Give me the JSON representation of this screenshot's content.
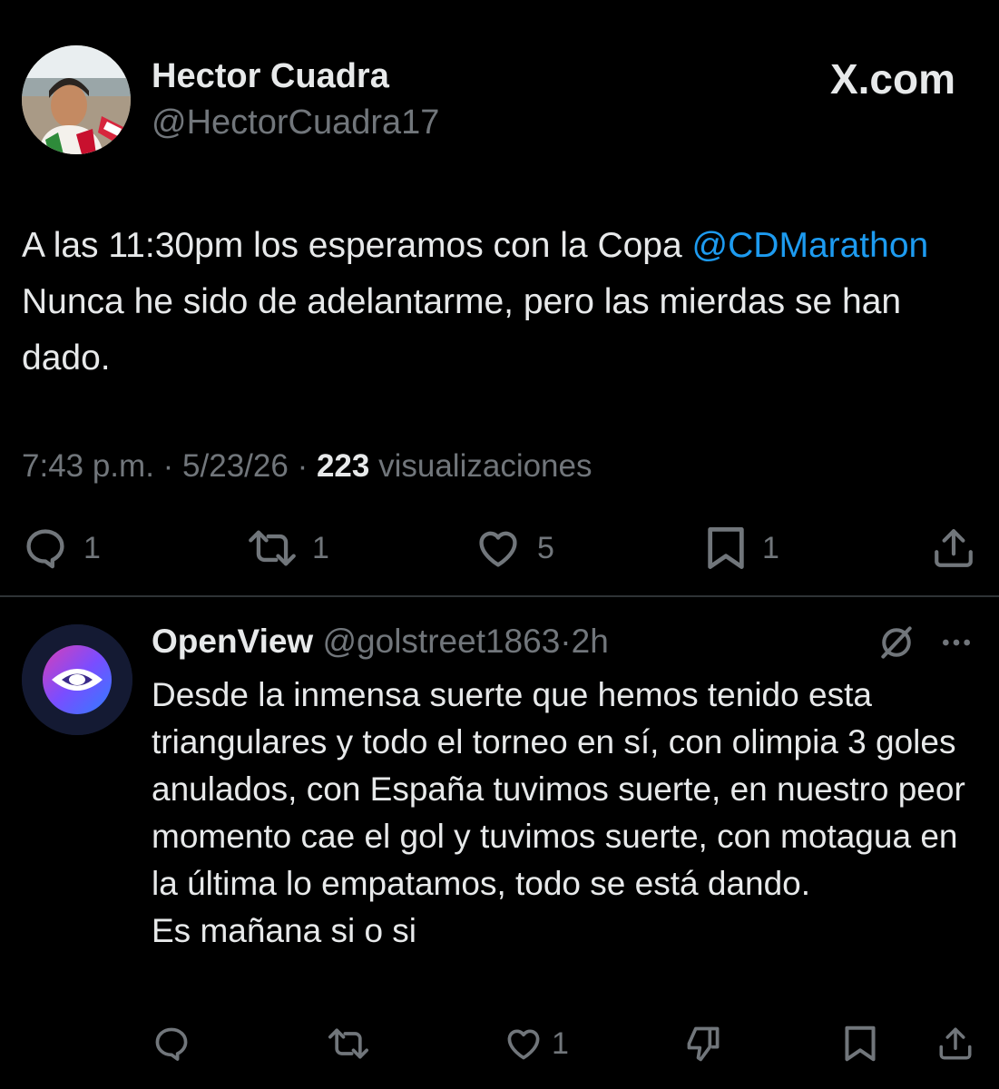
{
  "post": {
    "author_name": "Hector Cuadra",
    "author_handle": "@HectorCuadra17",
    "brand": "X.com",
    "text_before": "A las 11:30pm los esperamos con la Copa ",
    "mention": "@CDMarathon",
    "text_after": " Nunca he sido de adelantarme, pero las mierdas se han dado.",
    "time": "7:43 p.m.",
    "date": "5/23/26",
    "views_count": "223",
    "views_label": "visualizaciones",
    "separator": "·",
    "stats": {
      "replies": "1",
      "reposts": "1",
      "likes": "5",
      "bookmarks": "1"
    }
  },
  "reply": {
    "author_name": "OpenView",
    "author_handle": "@golstreet1863",
    "separator": "·",
    "time": "2h",
    "text": "Desde la inmensa suerte que hemos tenido esta triangulares y todo el torneo en sí, con olimpia 3 goles anulados, con España tuvimos suerte, en nuestro peor momento cae el gol y tuvimos suerte, con motagua en la última lo empatamos, todo se está dando.\nEs mañana si o si",
    "stats": {
      "likes": "1"
    }
  },
  "colors": {
    "background": "#000000",
    "text": "#e7e9ea",
    "muted": "#71767b",
    "link": "#1d9bf0",
    "divider": "#2f3336"
  },
  "icons": {
    "reply": "speech-bubble-icon",
    "repost": "repost-arrows-icon",
    "like": "heart-icon",
    "bookmark": "bookmark-icon",
    "share": "share-upload-icon",
    "grok": "grok-slash-circle-icon",
    "more": "more-dots-icon",
    "dislike": "thumbs-down-icon"
  }
}
